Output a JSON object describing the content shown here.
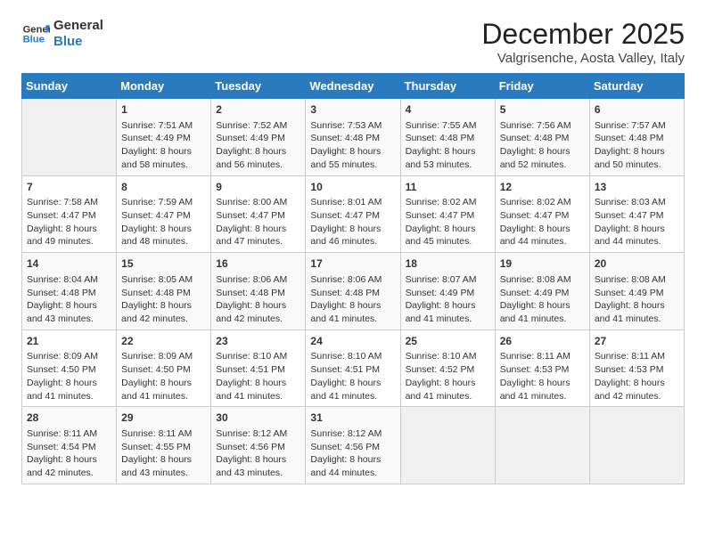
{
  "header": {
    "logo_line1": "General",
    "logo_line2": "Blue",
    "month": "December 2025",
    "location": "Valgrisenche, Aosta Valley, Italy"
  },
  "days_of_week": [
    "Sunday",
    "Monday",
    "Tuesday",
    "Wednesday",
    "Thursday",
    "Friday",
    "Saturday"
  ],
  "weeks": [
    [
      {
        "day": "",
        "info": ""
      },
      {
        "day": "1",
        "info": "Sunrise: 7:51 AM\nSunset: 4:49 PM\nDaylight: 8 hours\nand 58 minutes."
      },
      {
        "day": "2",
        "info": "Sunrise: 7:52 AM\nSunset: 4:49 PM\nDaylight: 8 hours\nand 56 minutes."
      },
      {
        "day": "3",
        "info": "Sunrise: 7:53 AM\nSunset: 4:48 PM\nDaylight: 8 hours\nand 55 minutes."
      },
      {
        "day": "4",
        "info": "Sunrise: 7:55 AM\nSunset: 4:48 PM\nDaylight: 8 hours\nand 53 minutes."
      },
      {
        "day": "5",
        "info": "Sunrise: 7:56 AM\nSunset: 4:48 PM\nDaylight: 8 hours\nand 52 minutes."
      },
      {
        "day": "6",
        "info": "Sunrise: 7:57 AM\nSunset: 4:48 PM\nDaylight: 8 hours\nand 50 minutes."
      }
    ],
    [
      {
        "day": "7",
        "info": "Sunrise: 7:58 AM\nSunset: 4:47 PM\nDaylight: 8 hours\nand 49 minutes."
      },
      {
        "day": "8",
        "info": "Sunrise: 7:59 AM\nSunset: 4:47 PM\nDaylight: 8 hours\nand 48 minutes."
      },
      {
        "day": "9",
        "info": "Sunrise: 8:00 AM\nSunset: 4:47 PM\nDaylight: 8 hours\nand 47 minutes."
      },
      {
        "day": "10",
        "info": "Sunrise: 8:01 AM\nSunset: 4:47 PM\nDaylight: 8 hours\nand 46 minutes."
      },
      {
        "day": "11",
        "info": "Sunrise: 8:02 AM\nSunset: 4:47 PM\nDaylight: 8 hours\nand 45 minutes."
      },
      {
        "day": "12",
        "info": "Sunrise: 8:02 AM\nSunset: 4:47 PM\nDaylight: 8 hours\nand 44 minutes."
      },
      {
        "day": "13",
        "info": "Sunrise: 8:03 AM\nSunset: 4:47 PM\nDaylight: 8 hours\nand 44 minutes."
      }
    ],
    [
      {
        "day": "14",
        "info": "Sunrise: 8:04 AM\nSunset: 4:48 PM\nDaylight: 8 hours\nand 43 minutes."
      },
      {
        "day": "15",
        "info": "Sunrise: 8:05 AM\nSunset: 4:48 PM\nDaylight: 8 hours\nand 42 minutes."
      },
      {
        "day": "16",
        "info": "Sunrise: 8:06 AM\nSunset: 4:48 PM\nDaylight: 8 hours\nand 42 minutes."
      },
      {
        "day": "17",
        "info": "Sunrise: 8:06 AM\nSunset: 4:48 PM\nDaylight: 8 hours\nand 41 minutes."
      },
      {
        "day": "18",
        "info": "Sunrise: 8:07 AM\nSunset: 4:49 PM\nDaylight: 8 hours\nand 41 minutes."
      },
      {
        "day": "19",
        "info": "Sunrise: 8:08 AM\nSunset: 4:49 PM\nDaylight: 8 hours\nand 41 minutes."
      },
      {
        "day": "20",
        "info": "Sunrise: 8:08 AM\nSunset: 4:49 PM\nDaylight: 8 hours\nand 41 minutes."
      }
    ],
    [
      {
        "day": "21",
        "info": "Sunrise: 8:09 AM\nSunset: 4:50 PM\nDaylight: 8 hours\nand 41 minutes."
      },
      {
        "day": "22",
        "info": "Sunrise: 8:09 AM\nSunset: 4:50 PM\nDaylight: 8 hours\nand 41 minutes."
      },
      {
        "day": "23",
        "info": "Sunrise: 8:10 AM\nSunset: 4:51 PM\nDaylight: 8 hours\nand 41 minutes."
      },
      {
        "day": "24",
        "info": "Sunrise: 8:10 AM\nSunset: 4:51 PM\nDaylight: 8 hours\nand 41 minutes."
      },
      {
        "day": "25",
        "info": "Sunrise: 8:10 AM\nSunset: 4:52 PM\nDaylight: 8 hours\nand 41 minutes."
      },
      {
        "day": "26",
        "info": "Sunrise: 8:11 AM\nSunset: 4:53 PM\nDaylight: 8 hours\nand 41 minutes."
      },
      {
        "day": "27",
        "info": "Sunrise: 8:11 AM\nSunset: 4:53 PM\nDaylight: 8 hours\nand 42 minutes."
      }
    ],
    [
      {
        "day": "28",
        "info": "Sunrise: 8:11 AM\nSunset: 4:54 PM\nDaylight: 8 hours\nand 42 minutes."
      },
      {
        "day": "29",
        "info": "Sunrise: 8:11 AM\nSunset: 4:55 PM\nDaylight: 8 hours\nand 43 minutes."
      },
      {
        "day": "30",
        "info": "Sunrise: 8:12 AM\nSunset: 4:56 PM\nDaylight: 8 hours\nand 43 minutes."
      },
      {
        "day": "31",
        "info": "Sunrise: 8:12 AM\nSunset: 4:56 PM\nDaylight: 8 hours\nand 44 minutes."
      },
      {
        "day": "",
        "info": ""
      },
      {
        "day": "",
        "info": ""
      },
      {
        "day": "",
        "info": ""
      }
    ]
  ]
}
